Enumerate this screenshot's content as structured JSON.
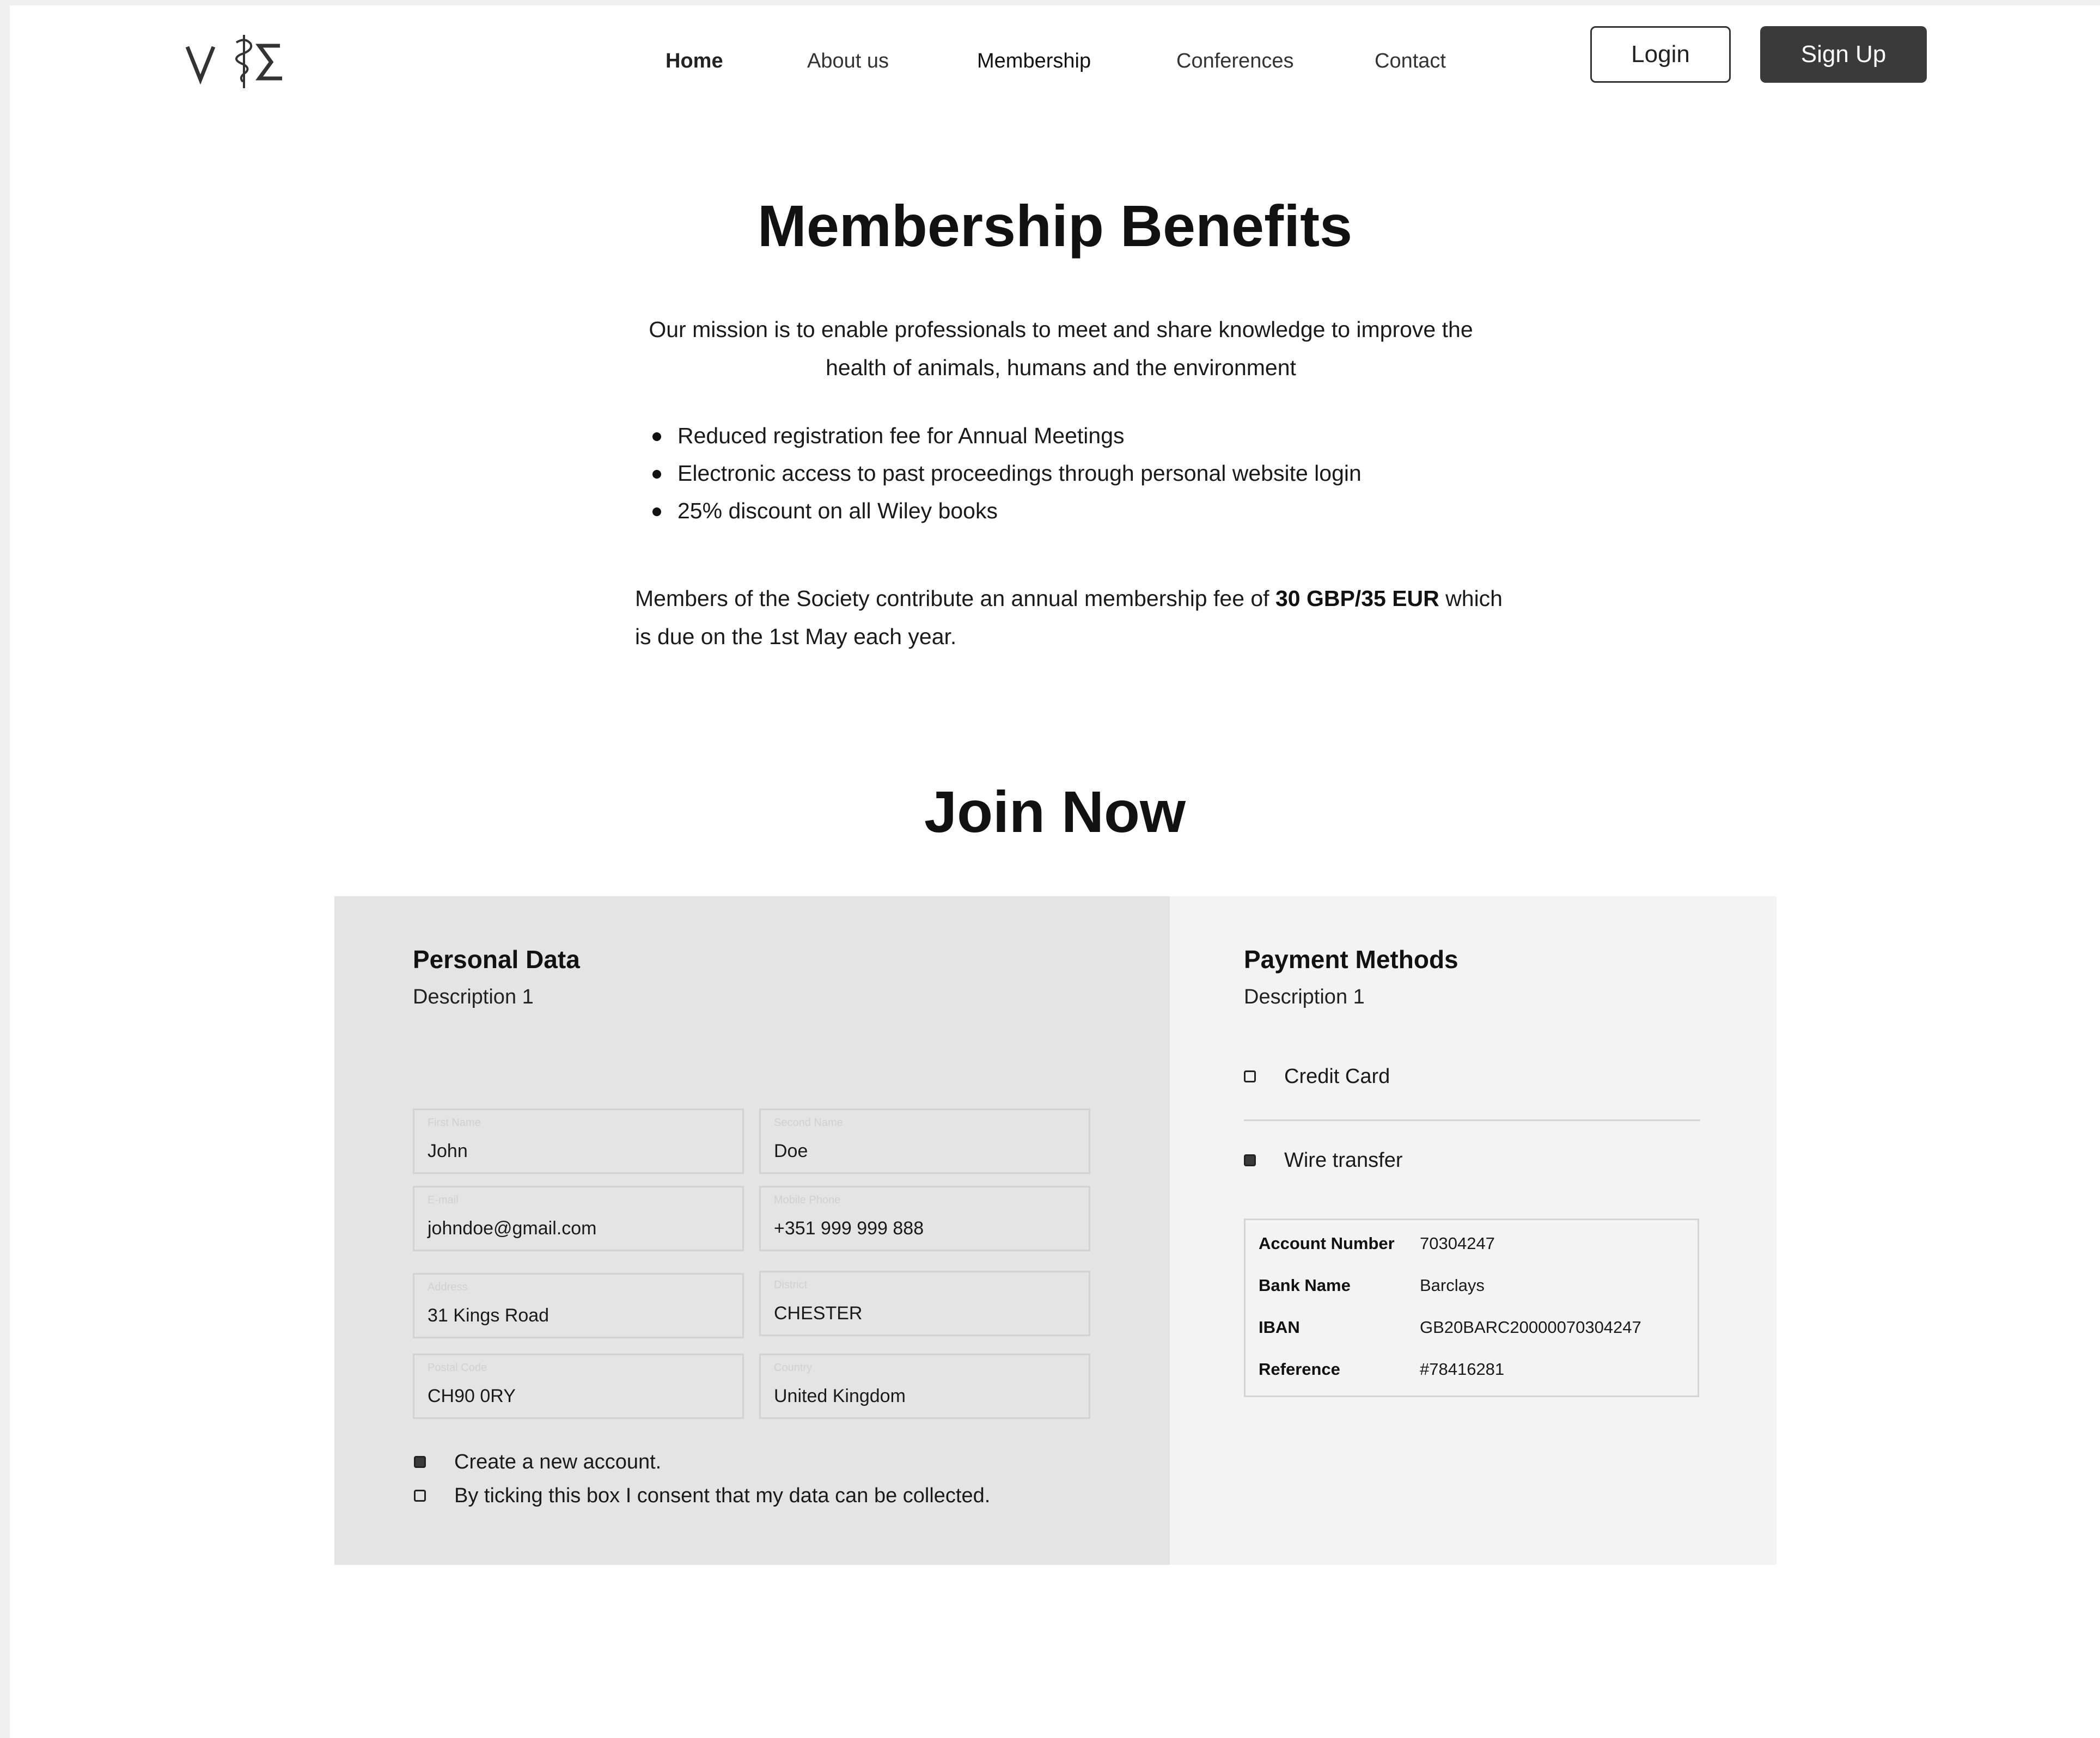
{
  "nav": {
    "items": [
      "Home",
      "About us",
      "Membership",
      "Conferences",
      "Contact"
    ],
    "login_label": "Login",
    "signup_label": "Sign Up"
  },
  "benefits": {
    "title": "Membership Benefits",
    "mission": "Our mission is to enable professionals to meet and share knowledge to improve the health of animals, humans and the environment",
    "items": [
      "Reduced registration fee for Annual Meetings",
      "Electronic access to past proceedings through personal website login",
      "25% discount on all Wiley books"
    ],
    "fee_prefix": "Members of the Society contribute an annual membership fee of ",
    "fee_amount": "30 GBP/35 EUR",
    "fee_suffix": " which is due on the 1st May each year."
  },
  "join": {
    "title": "Join Now",
    "personal": {
      "title": "Personal Data",
      "description": "Description 1",
      "fields": [
        {
          "label": "First Name",
          "value": "John"
        },
        {
          "label": "Second Name",
          "value": "Doe"
        },
        {
          "label": "E-mail",
          "value": "johndoe@gmail.com"
        },
        {
          "label": "Mobile Phone",
          "value": "+351 999 999 888"
        },
        {
          "label": "Address",
          "value": "31 Kings Road"
        },
        {
          "label": "District",
          "value": "CHESTER"
        },
        {
          "label": "Postal Code",
          "value": "CH90 0RY"
        },
        {
          "label": "Country",
          "value": "United Kingdom"
        }
      ],
      "checkboxes": [
        {
          "label": "Create a new account.",
          "checked": true
        },
        {
          "label": "By ticking this box I consent that my data can be collected.",
          "checked": false
        }
      ]
    },
    "payment": {
      "title": "Payment Methods",
      "description": "Description 1",
      "options": [
        {
          "label": "Credit Card",
          "checked": false
        },
        {
          "label": "Wire transfer",
          "checked": true
        }
      ],
      "bank": [
        {
          "key": "Account Number",
          "value": "70304247"
        },
        {
          "key": "Bank Name",
          "value": "Barclays"
        },
        {
          "key": "IBAN",
          "value": "GB20BARC20000070304247"
        },
        {
          "key": "Reference",
          "value": "#78416281"
        }
      ]
    }
  },
  "colors": {
    "primary_button": "#3a3a3a",
    "panel_left": "#e4e4e4",
    "panel_right": "#f3f3f3"
  }
}
